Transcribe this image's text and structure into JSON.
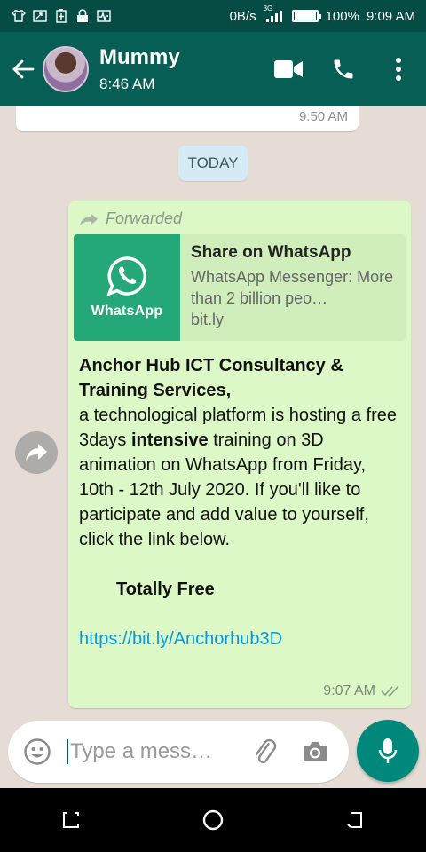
{
  "status_bar": {
    "speed": "0B/s",
    "network": "3G",
    "battery": "100%",
    "battery_level": 1.0,
    "time": "9:09 AM"
  },
  "header": {
    "contact_name": "Mummy",
    "last_seen": "8:46 AM",
    "icons": [
      "back-arrow-icon",
      "video-call-icon",
      "voice-call-icon",
      "more-options-icon"
    ]
  },
  "chat": {
    "previous_message_time": "9:50 AM",
    "date_divider": "TODAY",
    "message": {
      "forwarded_label": "Forwarded",
      "link_preview": {
        "image_caption": "WhatsApp",
        "title": "Share on WhatsApp",
        "description": "WhatsApp Messenger: More than 2 billion peo…",
        "domain": "bit.ly"
      },
      "bold_heading": "Anchor Hub ICT Consultancy & Training Services,",
      "text_part1": "a technological platform is hosting a free 3days ",
      "text_bold": "intensive",
      "text_part2": " training on 3D animation on WhatsApp from Friday, 10th  - 12th July 2020. If you'll like to participate and add value to yourself, click the link below.",
      "highlight": "Totally Free",
      "link": "https://bit.ly/Anchorhub3D",
      "time": "9:07 AM",
      "read_status": "double-check-icon"
    }
  },
  "composer": {
    "placeholder": "Type a mess…"
  },
  "colors": {
    "header": "#075e54",
    "status_bar": "#054d44",
    "outgoing_bubble": "#dcf8c6",
    "mic_button": "#00897b",
    "link": "#039be5"
  }
}
